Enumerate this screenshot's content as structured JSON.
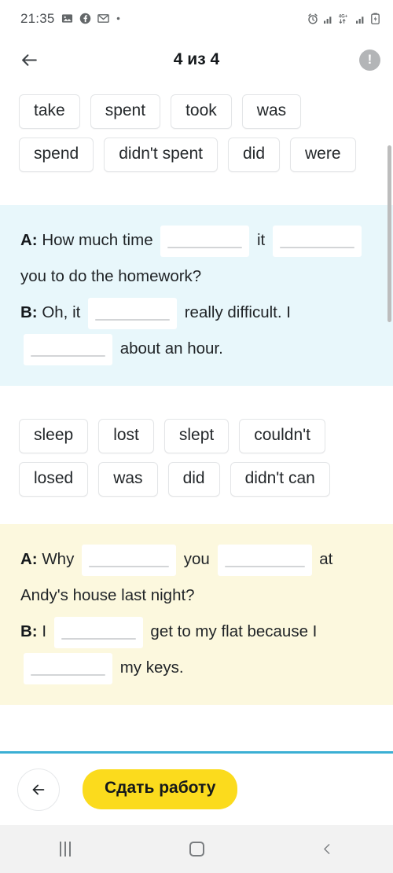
{
  "status_bar": {
    "clock": "21:35",
    "left_icons": [
      "photos-icon",
      "facebook-icon",
      "gmail-icon",
      "dot-icon"
    ],
    "right_icons": [
      "alarm-icon",
      "signal-bars-icon",
      "network-4g-plus-icon",
      "signal-bars-icon",
      "battery-icon"
    ],
    "network_label": "4G+"
  },
  "header": {
    "back_label": "back-arrow",
    "title": "4 из 4",
    "info_label": "!"
  },
  "exercise_1": {
    "words": [
      "take",
      "spent",
      "took",
      "was",
      "spend",
      "didn't spent",
      "did",
      "were"
    ],
    "panel_color": "#e8f7fb",
    "lines": [
      {
        "speaker": "A:",
        "parts": [
          {
            "type": "text",
            "value": " How much time "
          },
          {
            "type": "blank",
            "value": ""
          },
          {
            "type": "text",
            "value": " it "
          },
          {
            "type": "blank",
            "value": ""
          },
          {
            "type": "text",
            "value": " you to do the homework?"
          }
        ]
      },
      {
        "speaker": "B:",
        "parts": [
          {
            "type": "text",
            "value": " Oh, it "
          },
          {
            "type": "blank",
            "value": ""
          },
          {
            "type": "text",
            "value": " really difficult. I "
          },
          {
            "type": "blank",
            "value": ""
          },
          {
            "type": "text",
            "value": " about an hour."
          }
        ]
      }
    ]
  },
  "exercise_2": {
    "words": [
      "sleep",
      "lost",
      "slept",
      "couldn't",
      "losed",
      "was",
      "did",
      "didn't can"
    ],
    "panel_color": "#fcf8de",
    "lines": [
      {
        "speaker": "A:",
        "parts": [
          {
            "type": "text",
            "value": " Why "
          },
          {
            "type": "blank",
            "value": ""
          },
          {
            "type": "text",
            "value": " you "
          },
          {
            "type": "blank",
            "value": ""
          },
          {
            "type": "text",
            "value": " at Andy's house last night?"
          }
        ]
      },
      {
        "speaker": "B:",
        "parts": [
          {
            "type": "text",
            "value": " I "
          },
          {
            "type": "blank",
            "value": ""
          },
          {
            "type": "text",
            "value": " get to my flat because I "
          },
          {
            "type": "blank",
            "value": ""
          },
          {
            "type": "text",
            "value": " my keys."
          }
        ]
      }
    ]
  },
  "bottom_bar": {
    "prev_label": "previous-arrow",
    "submit_label": "Сдать работу",
    "accent_color": "#fbdb1d",
    "divider_color": "#3bafd4"
  },
  "nav_bar": {
    "recents_label": "recents",
    "home_label": "home",
    "back_label": "back"
  },
  "line_texts": {
    "e1_l1_p1": " How much time ",
    "e1_l1_p2": " it ",
    "e1_l1_p3": " you to do the homework?",
    "e1_l2_p1": " Oh, it ",
    "e1_l2_p2": " really difficult. I ",
    "e1_l2_p3": " about an hour.",
    "e2_l1_p1": " Why ",
    "e2_l1_p2": " you ",
    "e2_l1_p3": " at Andy's house last night?",
    "e2_l2_p1": " I ",
    "e2_l2_p2": " get to my flat because I ",
    "e2_l2_p3": " my keys."
  }
}
